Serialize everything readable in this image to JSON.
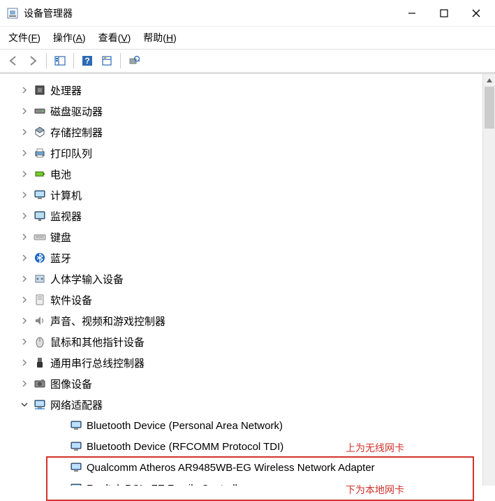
{
  "window": {
    "title": "设备管理器"
  },
  "menus": {
    "file": "文件(F)",
    "action": "操作(A)",
    "view": "查看(V)",
    "help": "帮助(H)"
  },
  "categories": [
    {
      "label": "处理器",
      "icon": "cpu",
      "expanded": false
    },
    {
      "label": "磁盘驱动器",
      "icon": "disk",
      "expanded": false
    },
    {
      "label": "存储控制器",
      "icon": "storage",
      "expanded": false
    },
    {
      "label": "打印队列",
      "icon": "printer",
      "expanded": false
    },
    {
      "label": "电池",
      "icon": "battery",
      "expanded": false
    },
    {
      "label": "计算机",
      "icon": "computer",
      "expanded": false
    },
    {
      "label": "监视器",
      "icon": "monitor",
      "expanded": false
    },
    {
      "label": "键盘",
      "icon": "keyboard",
      "expanded": false
    },
    {
      "label": "蓝牙",
      "icon": "bluetooth",
      "expanded": false
    },
    {
      "label": "人体学输入设备",
      "icon": "hid",
      "expanded": false
    },
    {
      "label": "软件设备",
      "icon": "software",
      "expanded": false
    },
    {
      "label": "声音、视频和游戏控制器",
      "icon": "audio",
      "expanded": false
    },
    {
      "label": "鼠标和其他指针设备",
      "icon": "mouse",
      "expanded": false
    },
    {
      "label": "通用串行总线控制器",
      "icon": "usb",
      "expanded": false
    },
    {
      "label": "图像设备",
      "icon": "camera",
      "expanded": false
    },
    {
      "label": "网络适配器",
      "icon": "network",
      "expanded": true,
      "children": [
        {
          "label": "Bluetooth Device (Personal Area Network)"
        },
        {
          "label": "Bluetooth Device (RFCOMM Protocol TDI)"
        },
        {
          "label": "Qualcomm Atheros AR9485WB-EG Wireless Network Adapter"
        },
        {
          "label": "Realtek PCIe FE Family Controller"
        }
      ]
    }
  ],
  "annotations": {
    "top_note": "上为无线网卡",
    "bottom_note": "下为本地网卡"
  }
}
